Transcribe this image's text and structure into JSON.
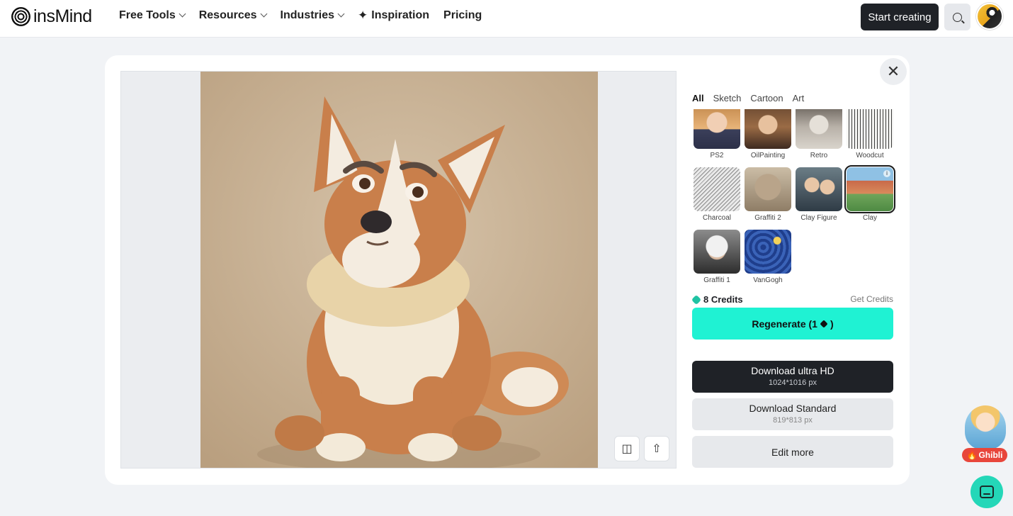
{
  "header": {
    "logo_text": "insMind",
    "nav": [
      {
        "label": "Free Tools",
        "has_dropdown": true
      },
      {
        "label": "Resources",
        "has_dropdown": true
      },
      {
        "label": "Industries",
        "has_dropdown": true
      },
      {
        "label": "Inspiration",
        "has_dropdown": false
      },
      {
        "label": "Pricing",
        "has_dropdown": false
      }
    ],
    "start_label": "Start creating",
    "search_icon": "search-icon",
    "avatar_icon": "duck-avatar"
  },
  "modal": {
    "close_icon": "close-icon",
    "close_glyph": "✕",
    "tabs": [
      {
        "label": "All",
        "active": true
      },
      {
        "label": "Sketch",
        "active": false
      },
      {
        "label": "Cartoon",
        "active": false
      },
      {
        "label": "Art",
        "active": false
      }
    ],
    "styles": [
      {
        "label": "PS2",
        "selected": false
      },
      {
        "label": "OilPainting",
        "selected": false
      },
      {
        "label": "Retro",
        "selected": false
      },
      {
        "label": "Woodcut",
        "selected": false
      },
      {
        "label": "Charcoal",
        "selected": false
      },
      {
        "label": "Graffiti 2",
        "selected": false
      },
      {
        "label": "Clay Figure",
        "selected": false
      },
      {
        "label": "Clay",
        "selected": true
      },
      {
        "label": "Graffiti 1",
        "selected": false
      },
      {
        "label": "VanGogh",
        "selected": false
      }
    ],
    "credits_label": "8 Credits",
    "get_credits_label": "Get Credits",
    "regenerate": {
      "label_start": "Regenerate (1",
      "label_end": ")"
    },
    "download_hd": {
      "title": "Download ultra HD",
      "size": "1024*1016 px"
    },
    "download_standard": {
      "title": "Download Standard",
      "size": "819*813 px"
    },
    "edit_label": "Edit more",
    "tools": [
      "compare-icon",
      "upload-icon"
    ]
  },
  "floating": {
    "ghibli_label": "Ghibli",
    "chat_icon": "chat-icon"
  },
  "colors": {
    "accent": "#1ff2d3",
    "dark_button": "#1f2227",
    "badge": "#e8463b",
    "chat": "#24d7b8"
  }
}
